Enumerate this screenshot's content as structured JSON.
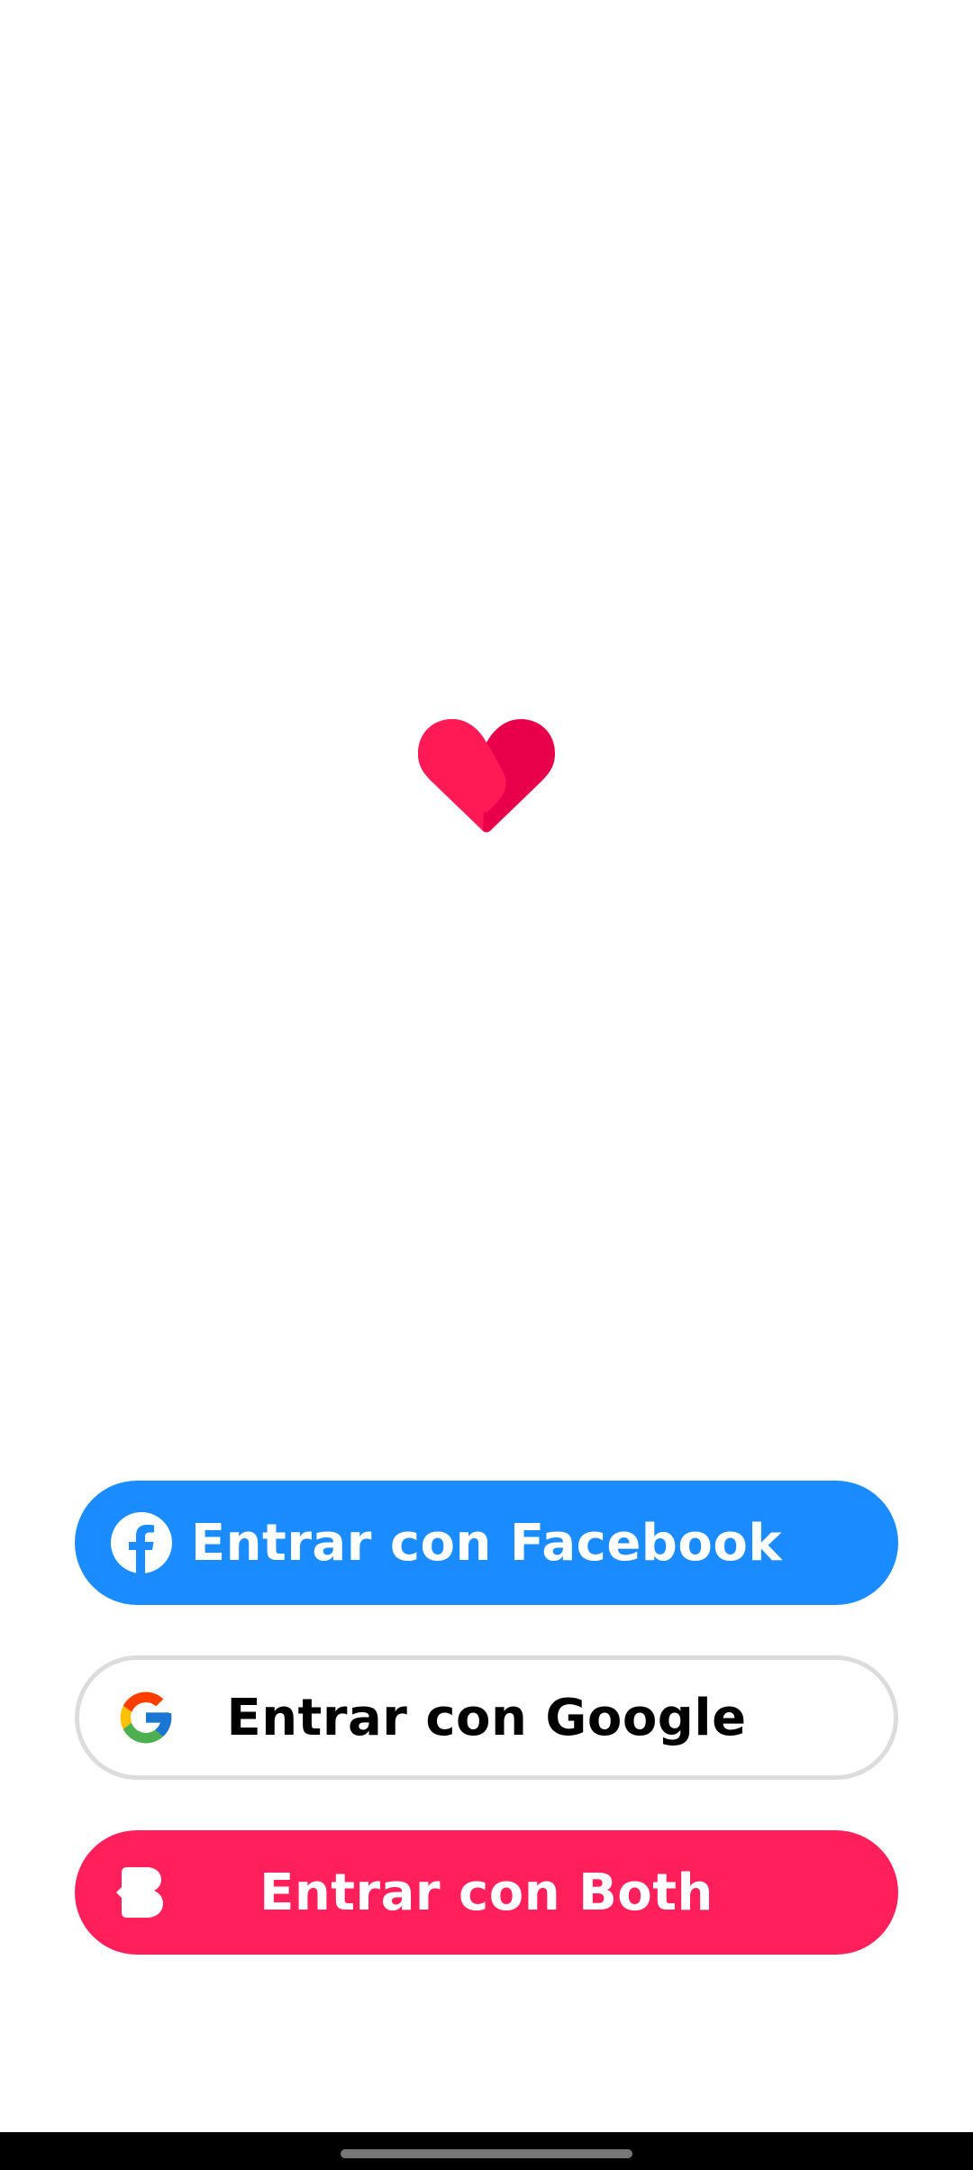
{
  "colors": {
    "facebook": "#1a8cff",
    "google_border": "#dcdcdc",
    "both": "#ff1f5a",
    "heart_left": "#ff1a55",
    "heart_right": "#e8004a"
  },
  "logo": {
    "icon": "heart-icon"
  },
  "buttons": {
    "facebook": {
      "label": "Entrar con Facebook",
      "icon": "facebook-icon"
    },
    "google": {
      "label": "Entrar con Google",
      "icon": "google-icon"
    },
    "both": {
      "label": "Entrar con Both",
      "icon": "both-logo-icon"
    }
  }
}
